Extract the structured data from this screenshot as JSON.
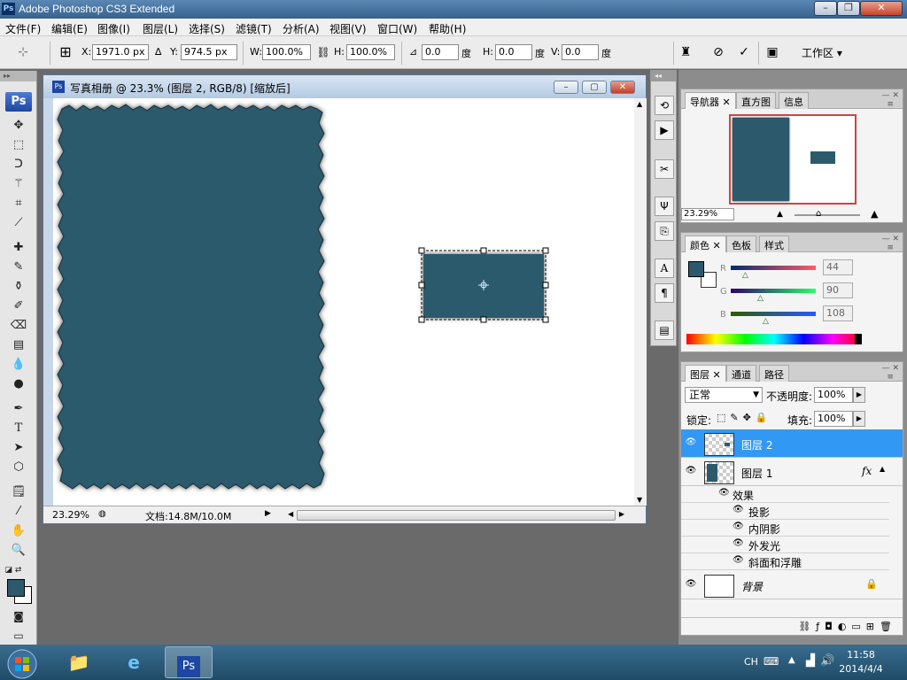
{
  "app": {
    "title": "Adobe Photoshop CS3 Extended",
    "logo": "Ps"
  },
  "window_controls": {
    "minimize": "–",
    "restore": "❐",
    "close": "✕"
  },
  "menu": [
    "文件(F)",
    "编辑(E)",
    "图像(I)",
    "图层(L)",
    "选择(S)",
    "滤镜(T)",
    "分析(A)",
    "视图(V)",
    "窗口(W)",
    "帮助(H)"
  ],
  "options": {
    "x_label": "X:",
    "x_value": "1971.0 px",
    "y_label": "Y:",
    "y_value": "974.5 px",
    "w_label": "W:",
    "w_value": "100.0%",
    "h_label": "H:",
    "h_value": "100.0%",
    "angle_value": "0.0",
    "angle_unit": "度",
    "hskew_label": "H:",
    "hskew_value": "0.0",
    "hskew_unit": "度",
    "vskew_label": "V:",
    "vskew_value": "0.0",
    "vskew_unit": "度",
    "workspace": "工作区 ▾"
  },
  "document": {
    "title": "写真相册 @ 23.3% (图层 2, RGB/8) [缩放后]",
    "zoom": "23.29%",
    "doc_size": "文档:14.8M/10.0M",
    "fill_color": "#2c5a6c"
  },
  "navigator": {
    "tabs": [
      "导航器",
      "直方图",
      "信息"
    ],
    "zoom": "23.29%"
  },
  "color": {
    "tabs": [
      "颜色",
      "色板",
      "样式"
    ],
    "r_label": "R",
    "r": "44",
    "g_label": "G",
    "g": "90",
    "b_label": "B",
    "b": "108"
  },
  "layers": {
    "tabs": [
      "图层",
      "通道",
      "路径"
    ],
    "blend_mode": "正常",
    "opacity_label": "不透明度:",
    "opacity": "100%",
    "lock_label": "锁定:",
    "fill_label": "填充:",
    "fill": "100%",
    "rows": [
      {
        "name": "图层 2"
      },
      {
        "name": "图层 1",
        "fx": "fx"
      },
      {
        "name": "背景"
      }
    ],
    "effects_label": "效果",
    "effects": [
      "投影",
      "内阴影",
      "外发光",
      "斜面和浮雕"
    ]
  },
  "taskbar": {
    "lang": "CH",
    "time": "11:58",
    "date": "2014/4/4"
  }
}
